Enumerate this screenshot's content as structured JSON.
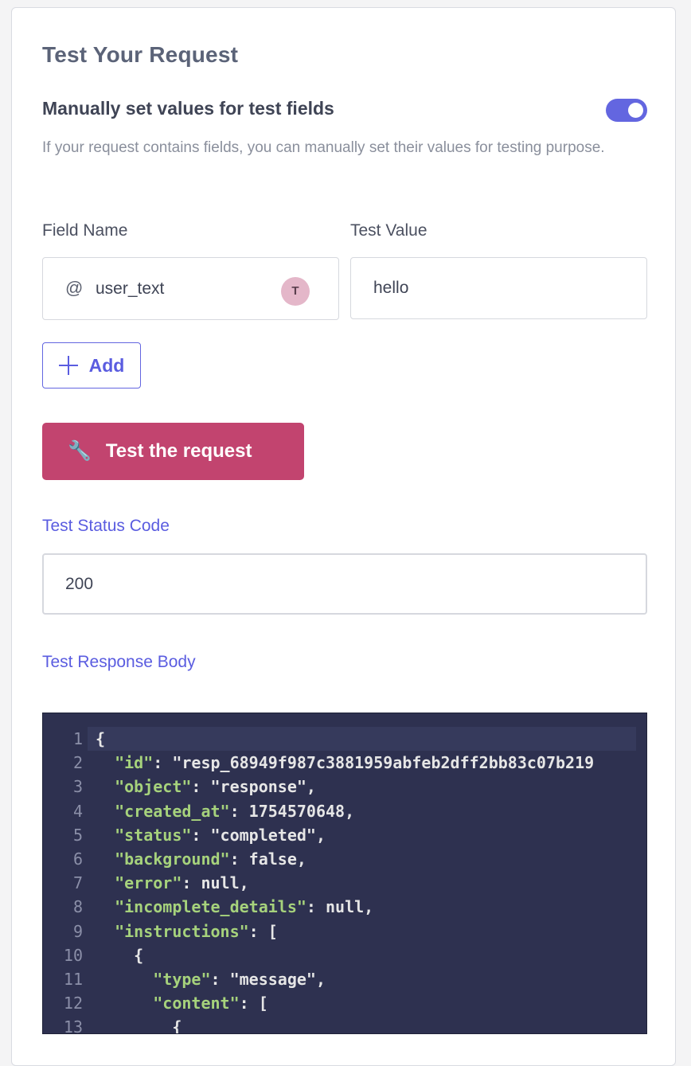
{
  "panel": {
    "title": "Test Your Request",
    "manual": {
      "title": "Manually set values for test fields",
      "enabled": true,
      "helper": "If your request contains fields, you can manually set their values for testing purpose."
    },
    "columns": {
      "field_name": "Field Name",
      "test_value": "Test Value"
    },
    "fields": [
      {
        "symbol": "@",
        "name": "user_text",
        "type_badge": "T",
        "value": "hello"
      }
    ],
    "add_label": "Add",
    "test_button_label": "Test the request",
    "status_label": "Test Status Code",
    "status_value": "200",
    "response_label": "Test Response Body"
  },
  "code_lines": [
    {
      "n": "1",
      "text": "{"
    },
    {
      "n": "2",
      "text": "  \"id\": \"resp_68949f987c3881959abfeb2dff2bb83c07b219"
    },
    {
      "n": "3",
      "text": "  \"object\": \"response\","
    },
    {
      "n": "4",
      "text": "  \"created_at\": 1754570648,"
    },
    {
      "n": "5",
      "text": "  \"status\": \"completed\","
    },
    {
      "n": "6",
      "text": "  \"background\": false,"
    },
    {
      "n": "7",
      "text": "  \"error\": null,"
    },
    {
      "n": "8",
      "text": "  \"incomplete_details\": null,"
    },
    {
      "n": "9",
      "text": "  \"instructions\": ["
    },
    {
      "n": "10",
      "text": "    {"
    },
    {
      "n": "11",
      "text": "      \"type\": \"message\","
    },
    {
      "n": "12",
      "text": "      \"content\": ["
    },
    {
      "n": "13",
      "text": "        {"
    }
  ],
  "colors": {
    "accent": "#6366e0",
    "primary_button": "#c2446f",
    "editor_bg": "#2e3150"
  }
}
